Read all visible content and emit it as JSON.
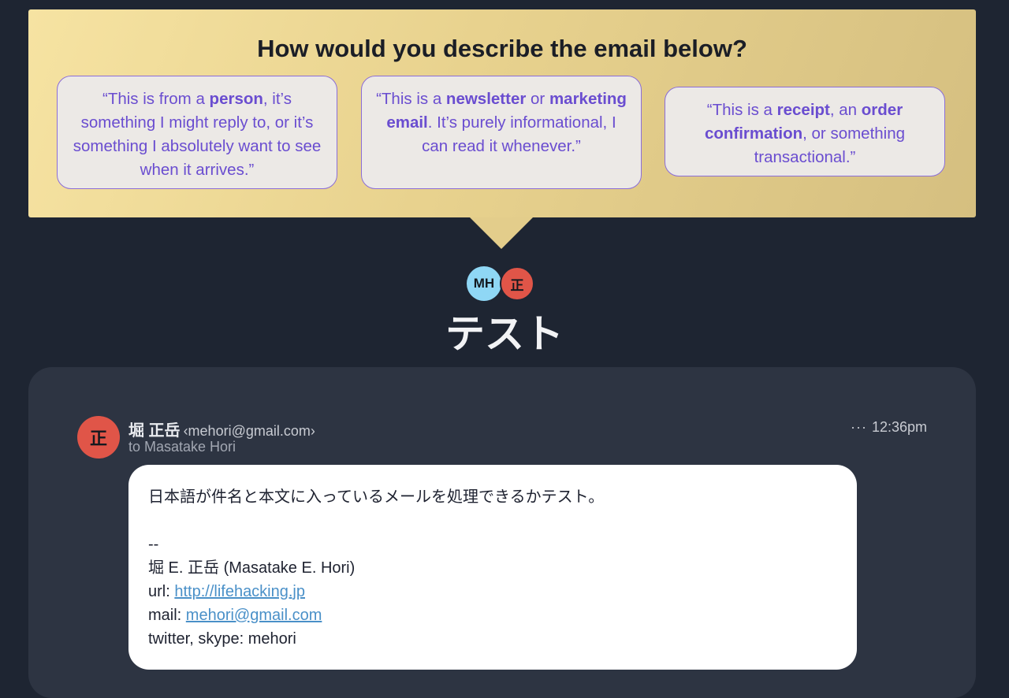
{
  "prompt": {
    "title": "How would you describe the email below?",
    "options": [
      {
        "parts": [
          {
            "text": "“This is from a "
          },
          {
            "text": "person",
            "bold": true
          },
          {
            "text": ", it’s something I might reply to, or it’s something I absolutely want to see when it arrives.”"
          }
        ]
      },
      {
        "parts": [
          {
            "text": "“This is a "
          },
          {
            "text": "newsletter",
            "bold": true
          },
          {
            "text": " or "
          },
          {
            "text": "marketing email",
            "bold": true
          },
          {
            "text": ". It’s purely informational, I can read it whenever.”"
          }
        ]
      },
      {
        "parts": [
          {
            "text": "“This is a "
          },
          {
            "text": "receipt",
            "bold": true
          },
          {
            "text": ", an "
          },
          {
            "text": "order confirmation",
            "bold": true
          },
          {
            "text": ", or something transactional.”"
          }
        ]
      }
    ]
  },
  "participants": [
    {
      "initials": "MH",
      "color": "#8fd7f5"
    },
    {
      "initials": "正",
      "color": "#e05548"
    }
  ],
  "subject": "テスト",
  "email": {
    "sender_avatar": "正",
    "sender_name": "堀 正岳",
    "sender_email": "‹mehori@gmail.com›",
    "recipient": "to Masatake Hori",
    "more_icon": "···",
    "time": "12:36pm",
    "body": {
      "line1": "日本語が件名と本文に入っているメールを処理できるかテスト。",
      "separator": "--",
      "signature_name": "堀 E. 正岳 (Masatake E. Hori)",
      "url_label": "url: ",
      "url": "http://lifehacking.jp",
      "mail_label": "mail: ",
      "mail": "mehori@gmail.com",
      "social": "twitter, skype: mehori"
    }
  },
  "colors": {
    "background": "#1e2532",
    "panel_gold": "#e8d28e",
    "accent_purple": "#6a4dd0",
    "link_blue": "#4a90c8"
  }
}
